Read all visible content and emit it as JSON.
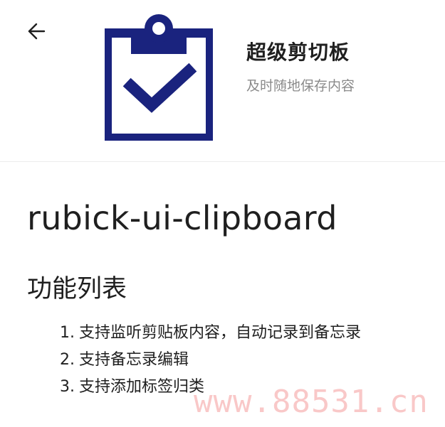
{
  "header": {
    "back_icon": "arrow-left-icon",
    "app_icon": "clipboard-check-icon",
    "title": "超级剪切板",
    "subtitle": "及时随地保存内容"
  },
  "content": {
    "plugin_name": "rubick-ui-clipboard",
    "section_title": "功能列表",
    "features": [
      {
        "num": "1.",
        "text": "支持监听剪贴板内容，自动记录到备忘录"
      },
      {
        "num": "2.",
        "text": "支持备忘录编辑"
      },
      {
        "num": "3.",
        "text": "支持添加标签归类"
      }
    ]
  },
  "watermark": "www.88531.cn",
  "colors": {
    "icon_navy": "#1a237e",
    "subtitle_gray": "#8a8a8a",
    "text": "#1f1f1f"
  }
}
